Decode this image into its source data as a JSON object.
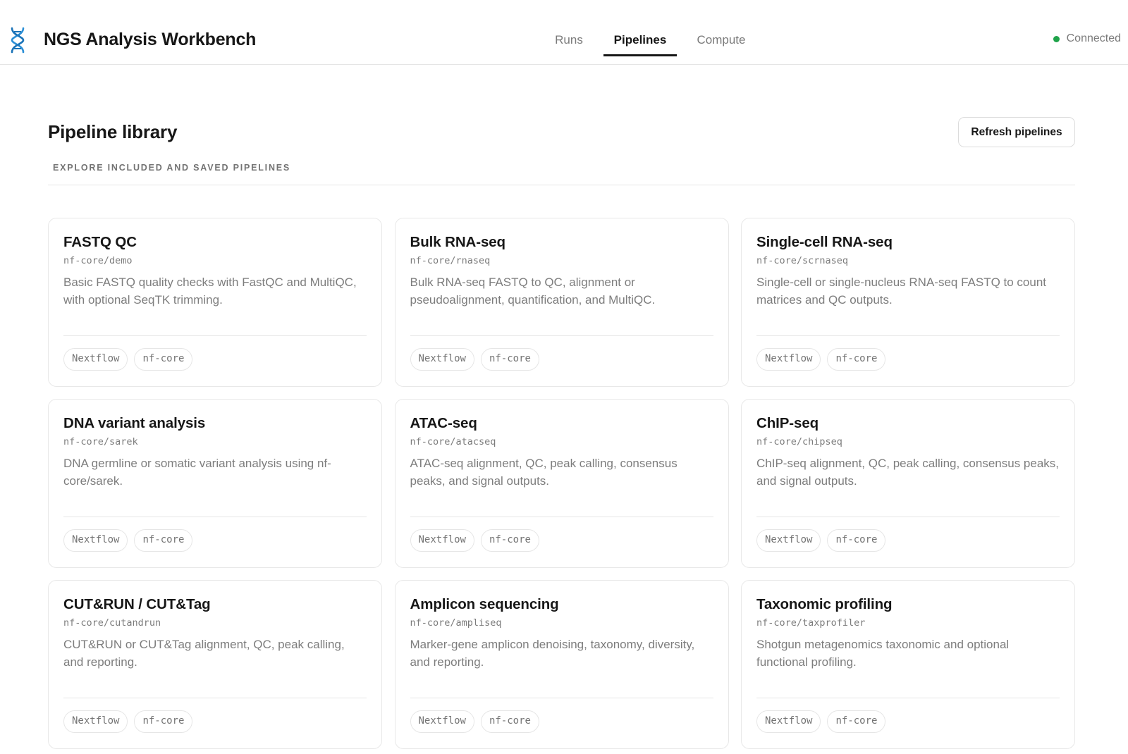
{
  "app": {
    "title": "NGS Analysis Workbench",
    "logo_icon": "dna-icon",
    "accent_color": "#1a73b8"
  },
  "nav": {
    "tabs": [
      {
        "label": "Runs",
        "active": false
      },
      {
        "label": "Pipelines",
        "active": true
      },
      {
        "label": "Compute",
        "active": false
      }
    ]
  },
  "status": {
    "label": "Connected",
    "color": "#1fa34a"
  },
  "page": {
    "title": "Pipeline library",
    "subtitle": "EXPLORE INCLUDED AND SAVED PIPELINES",
    "refresh_label": "Refresh pipelines"
  },
  "pipelines": [
    {
      "title": "FASTQ QC",
      "repo": "nf-core/demo",
      "description": "Basic FASTQ quality checks with FastQC and MultiQC, with optional SeqTK trimming.",
      "tags": [
        "Nextflow",
        "nf-core"
      ]
    },
    {
      "title": "Bulk RNA-seq",
      "repo": "nf-core/rnaseq",
      "description": "Bulk RNA-seq FASTQ to QC, alignment or pseudoalignment, quantification, and MultiQC.",
      "tags": [
        "Nextflow",
        "nf-core"
      ]
    },
    {
      "title": "Single-cell RNA-seq",
      "repo": "nf-core/scrnaseq",
      "description": "Single-cell or single-nucleus RNA-seq FASTQ to count matrices and QC outputs.",
      "tags": [
        "Nextflow",
        "nf-core"
      ]
    },
    {
      "title": "DNA variant analysis",
      "repo": "nf-core/sarek",
      "description": "DNA germline or somatic variant analysis using nf-core/sarek.",
      "tags": [
        "Nextflow",
        "nf-core"
      ]
    },
    {
      "title": "ATAC-seq",
      "repo": "nf-core/atacseq",
      "description": "ATAC-seq alignment, QC, peak calling, consensus peaks, and signal outputs.",
      "tags": [
        "Nextflow",
        "nf-core"
      ]
    },
    {
      "title": "ChIP-seq",
      "repo": "nf-core/chipseq",
      "description": "ChIP-seq alignment, QC, peak calling, consensus peaks, and signal outputs.",
      "tags": [
        "Nextflow",
        "nf-core"
      ]
    },
    {
      "title": "CUT&RUN / CUT&Tag",
      "repo": "nf-core/cutandrun",
      "description": "CUT&RUN or CUT&Tag alignment, QC, peak calling, and reporting.",
      "tags": [
        "Nextflow",
        "nf-core"
      ]
    },
    {
      "title": "Amplicon sequencing",
      "repo": "nf-core/ampliseq",
      "description": "Marker-gene amplicon denoising, taxonomy, diversity, and reporting.",
      "tags": [
        "Nextflow",
        "nf-core"
      ]
    },
    {
      "title": "Taxonomic profiling",
      "repo": "nf-core/taxprofiler",
      "description": "Shotgun metagenomics taxonomic and optional functional profiling.",
      "tags": [
        "Nextflow",
        "nf-core"
      ]
    }
  ]
}
